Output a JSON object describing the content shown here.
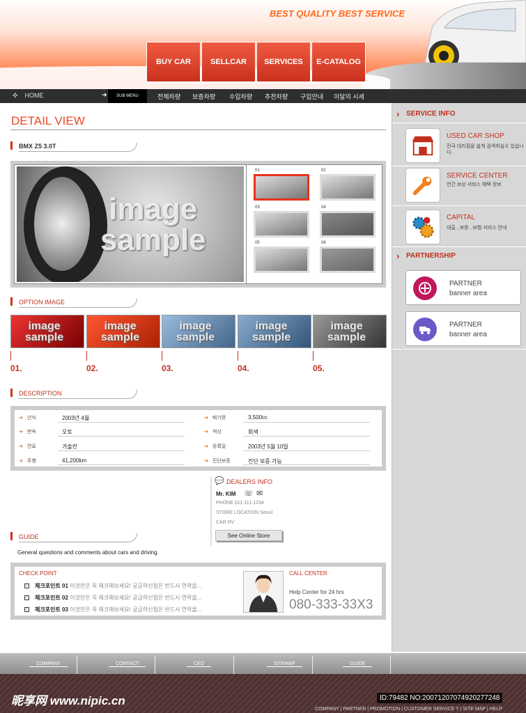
{
  "header": {
    "tagline": "BEST QUALITY BEST SERVICE",
    "nav": [
      "BUY CAR",
      "SELLCAR",
      "SERVICES",
      "E-CATALOG"
    ]
  },
  "subnav": {
    "home": "HOME",
    "submenu": "SUB MENU",
    "items": [
      "전체차량",
      "보증차량",
      "수입차량",
      "추천차량",
      "구입안내",
      "이달의 시세"
    ]
  },
  "main": {
    "page_title": "DETAIL VIEW",
    "car_name": "BMX Z5 3.0T",
    "image_text_1": "image",
    "image_text_2": "sample",
    "thumb_numbers": [
      "01",
      "02",
      "03",
      "04",
      "05",
      "06"
    ],
    "option_title": "OPTION IMAGE",
    "option_numbers": [
      "01.",
      "02.",
      "03.",
      "04.",
      "05."
    ],
    "description_title": "DESCRIPTION",
    "specs": [
      {
        "label": "년식",
        "value": "2003년 4월"
      },
      {
        "label": "변속",
        "value": "오토"
      },
      {
        "label": "연료",
        "value": "가솔린"
      },
      {
        "label": "주행",
        "value": "41,200km"
      },
      {
        "label": "배기량",
        "value": "3,500cc"
      },
      {
        "label": "색상",
        "value": "회색"
      },
      {
        "label": "등록일",
        "value": "2003년 5월 10일"
      },
      {
        "label": "진단보증",
        "value": "진단 보증 가능"
      }
    ],
    "dealers": {
      "title": "DEALERS INFO",
      "name": "Mr. KIM",
      "phone": "PHONE 011-111-1234",
      "store": "STORE LOCATION Seoul",
      "car": "CAR RV",
      "button": "See Online Store"
    },
    "guide": {
      "title": "GUIDE",
      "text": "General questions and comments about cars and driving."
    },
    "checkpoint": {
      "title": "CHECK POINT",
      "items": [
        {
          "label": "체크포인트 01",
          "text": "이것만은 꼭 체크해보세요! 궁금하신점은 반드시 연락을..."
        },
        {
          "label": "체크포인트 02",
          "text": "이것만은 꼭 체크해보세요! 궁금하신점은 반드시 연락을..."
        },
        {
          "label": "체크포인트 03",
          "text": "이것만은 꼭 체크해보세요! 궁금하신점은 반드시 연락을..."
        }
      ]
    },
    "callcenter": {
      "title": "CALL CENTER",
      "subtitle": "Help Center for 24 hrs",
      "phone": "080-333-33X3"
    }
  },
  "sidebar": {
    "service_title": "SERVICE INFO",
    "services": [
      {
        "title": "USED CAR SHOP",
        "desc": "전국 대리점을 쉽게 검색하실수 있습니다."
      },
      {
        "title": "SERVICE CENTER",
        "desc": "연간 보상 서비스 혜택 정보"
      },
      {
        "title": "CAPITAL",
        "desc": "대출 , 보증 , 보험 서비스 안내"
      }
    ],
    "partnership_title": "PARTNERSHIP",
    "partners": [
      {
        "title": "PARTNER",
        "desc": "banner area"
      },
      {
        "title": "PARTNER",
        "desc": "banner area"
      }
    ]
  },
  "footer": {
    "nav": [
      "COMPANY",
      "CONTACT",
      "CEO",
      "SITEMAP",
      "GUIDE"
    ],
    "links": "COMPANY | PARTNER | PROMOTION | CUSTOMER SERVICE Y | SITE MAP | HELP",
    "watermark": "昵享网 www.nipic.cn",
    "id_tag": "ID:79482 NO:20071207074920277248"
  },
  "colors": {
    "accent": "#c0301f",
    "orange": "#ff6a1a",
    "nav_red": "#d9432a"
  }
}
